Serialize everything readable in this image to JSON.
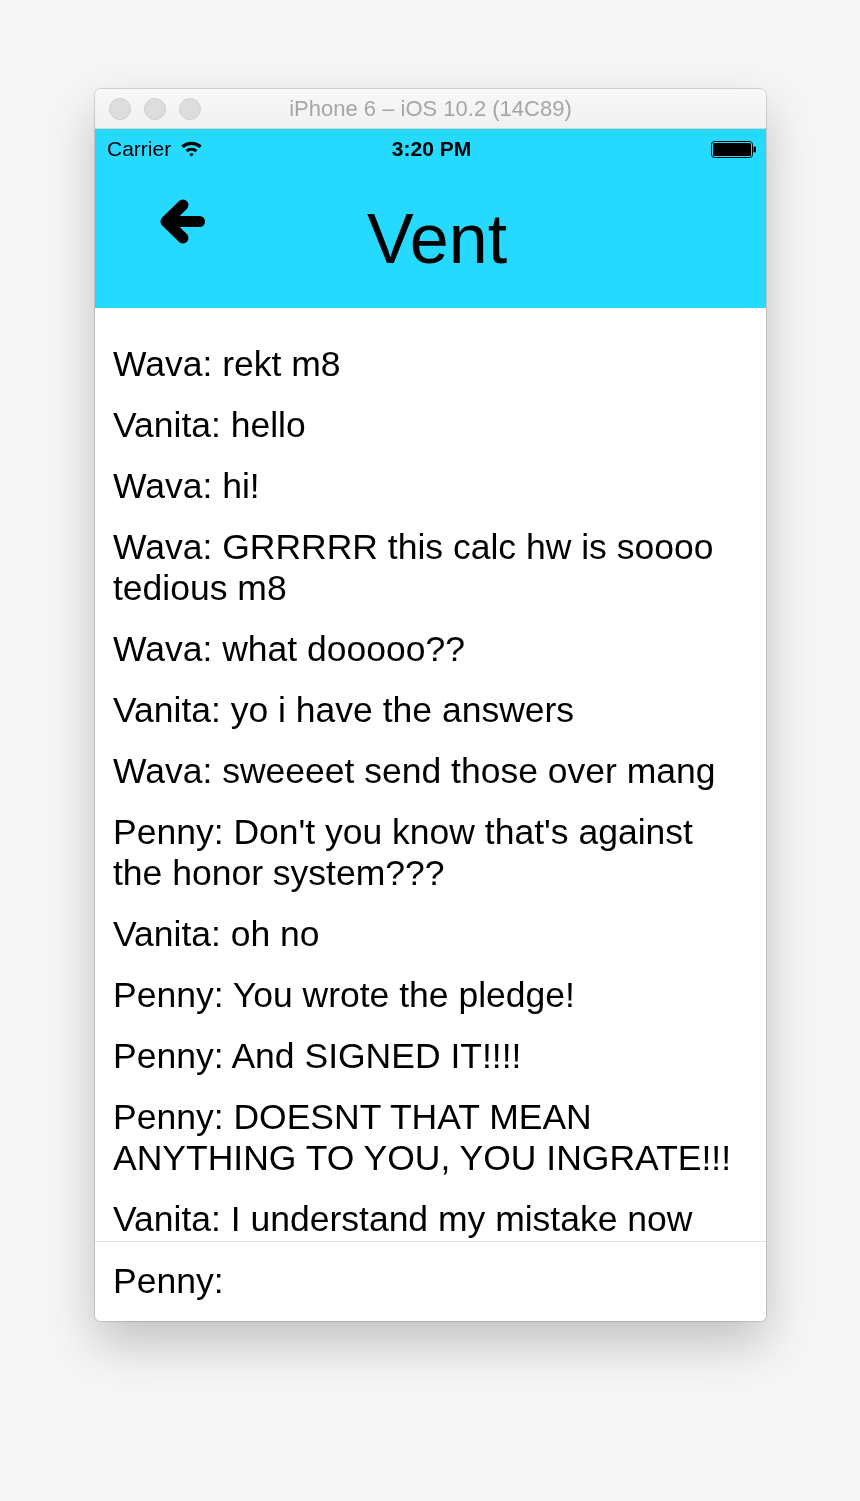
{
  "window": {
    "title": "iPhone 6 – iOS 10.2 (14C89)"
  },
  "status_bar": {
    "carrier": "Carrier",
    "time": "3:20 PM"
  },
  "nav_bar": {
    "title": "Vent"
  },
  "messages": [
    "Wava: rekt m8",
    "Vanita: hello",
    "Wava: hi!",
    "Wava: GRRRRR this calc hw is soooo tedious m8",
    "Wava: what dooooo??",
    "Vanita: yo i have the answers",
    "Wava: sweeeet send those over mang",
    "Penny: Don't you know that's against the honor system???",
    "Vanita: oh no",
    "Penny: You wrote the pledge!",
    "Penny: And SIGNED IT!!!!",
    "Penny: DOESNT THAT MEAN ANYTHING TO YOU, YOU INGRATE!!!",
    "Vanita: I understand my mistake now"
  ],
  "composer": {
    "value": "Penny:"
  }
}
